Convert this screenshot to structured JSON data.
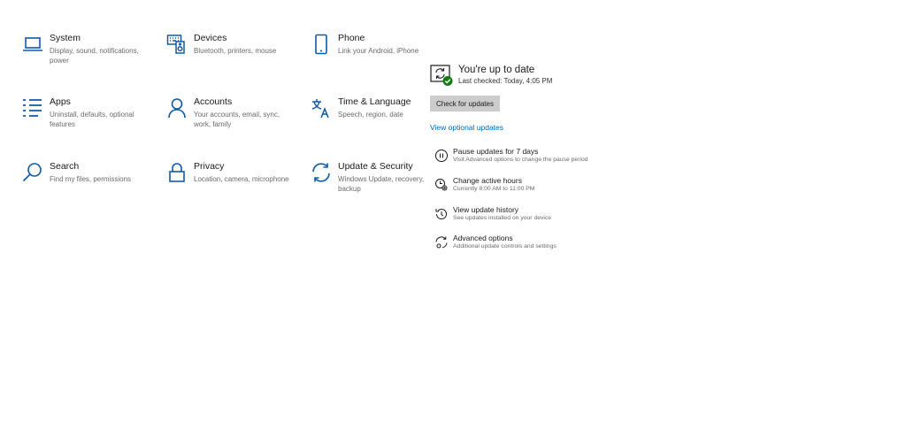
{
  "settings": {
    "tiles": [
      {
        "icon": "laptop-icon",
        "title": "System",
        "desc": "Display, sound, notifications, power"
      },
      {
        "icon": "keyboard-speaker-icon",
        "title": "Devices",
        "desc": "Bluetooth, printers, mouse"
      },
      {
        "icon": "phone-icon",
        "title": "Phone",
        "desc": "Link your Android, iPhone"
      },
      {
        "icon": "apps-list-icon",
        "title": "Apps",
        "desc": "Uninstall, defaults, optional features"
      },
      {
        "icon": "person-icon",
        "title": "Accounts",
        "desc": "Your accounts, email, sync, work, family"
      },
      {
        "icon": "language-icon",
        "title": "Time & Language",
        "desc": "Speech, region, date"
      },
      {
        "icon": "search-icon",
        "title": "Search",
        "desc": "Find my files, permissions"
      },
      {
        "icon": "lock-icon",
        "title": "Privacy",
        "desc": "Location, camera, microphone"
      },
      {
        "icon": "sync-icon",
        "title": "Update & Security",
        "desc": "Windows Update, recovery, backup"
      }
    ]
  },
  "update": {
    "status_icon": "update-status-icon",
    "status_title": "You're up to date",
    "status_sub": "Last checked: Today, 4:05 PM",
    "check_button": "Check for updates",
    "optional_link": "View optional updates",
    "options": [
      {
        "icon": "pause-icon",
        "title": "Pause updates for 7 days",
        "desc": "Visit Advanced options to change the pause period"
      },
      {
        "icon": "clock-gear-icon",
        "title": "Change active hours",
        "desc": "Currently 8:00 AM to 11:00 PM"
      },
      {
        "icon": "history-icon",
        "title": "View update history",
        "desc": "See updates installed on your device"
      },
      {
        "icon": "advanced-sync-icon",
        "title": "Advanced options",
        "desc": "Additional update controls and settings"
      }
    ],
    "accent": "#0067b8",
    "success": "#107c10"
  }
}
